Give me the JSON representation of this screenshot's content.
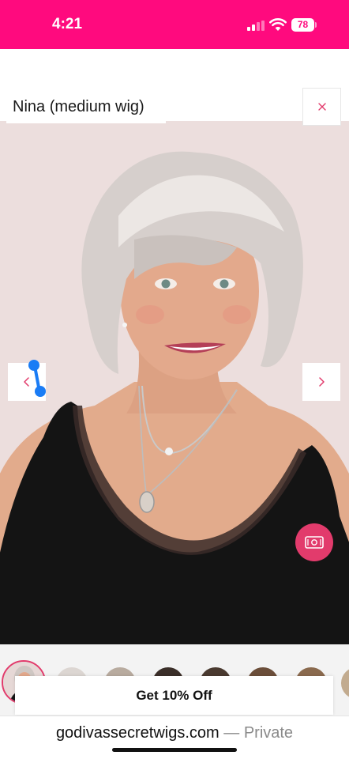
{
  "status_bar": {
    "time": "4:21",
    "battery_level": "78",
    "signal_bars_active": 2,
    "signal_bars_total": 4,
    "background_color": "#ff0a7e"
  },
  "product": {
    "title": "Nina (medium wig)"
  },
  "icons": {
    "close": "close-icon",
    "previous": "chevron-left-icon",
    "next": "chevron-right-icon",
    "price": "banknote-icon",
    "compare": "compare-slider-handle-icon"
  },
  "colors": {
    "accent_pink": "#ff0a7e",
    "button_pink": "#e23b6c",
    "handle_blue": "#1a7cf5",
    "photo_background": "#ecdedd"
  },
  "promo": {
    "label": "Get 10% Off"
  },
  "browser": {
    "domain": "godivassecretwigs.com",
    "separator": "—",
    "mode": "Private"
  }
}
